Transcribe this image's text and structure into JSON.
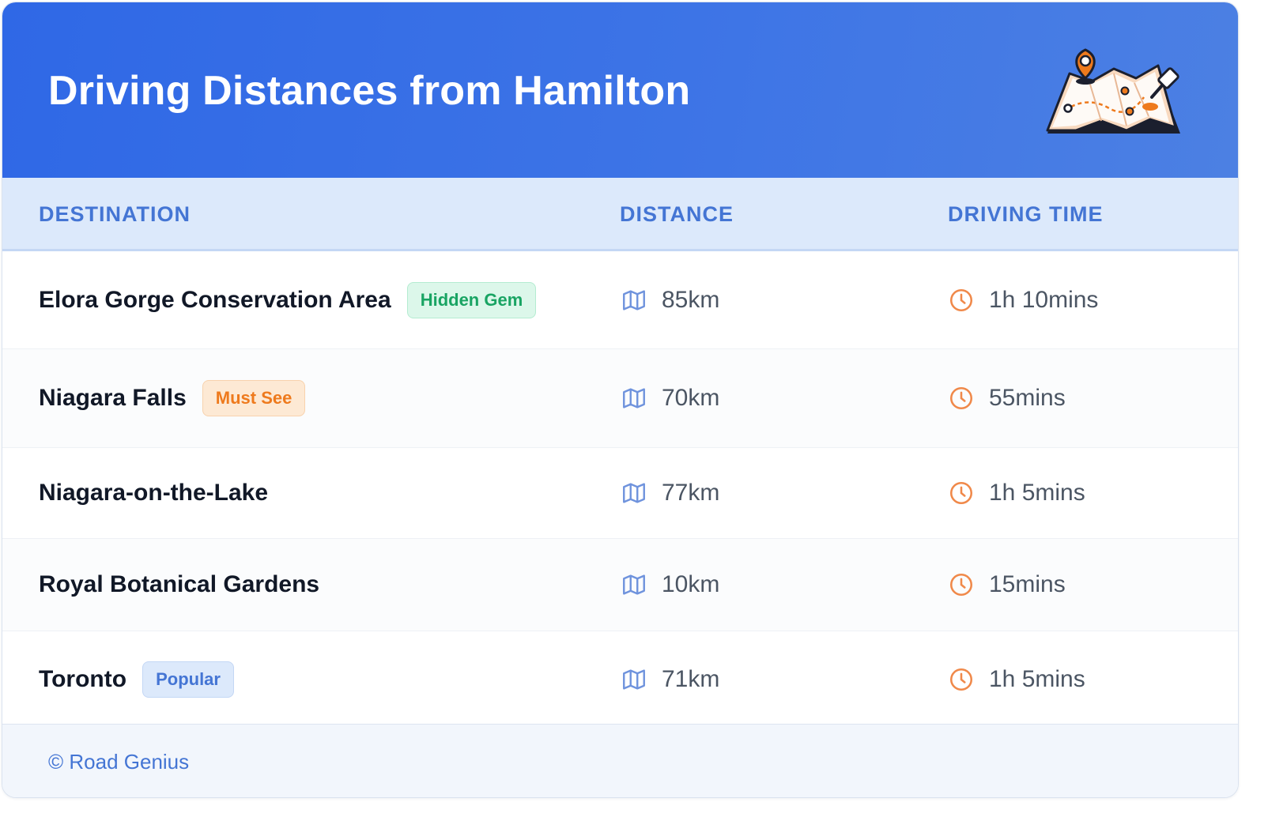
{
  "header": {
    "title": "Driving Distances from Hamilton",
    "illustration_icon": "map-with-pins-icon"
  },
  "columns": {
    "destination": "DESTINATION",
    "distance": "DISTANCE",
    "driving_time": "DRIVING TIME"
  },
  "rows": [
    {
      "destination": "Elora Gorge Conservation Area",
      "badge": "Hidden Gem",
      "badge_type": "hidden",
      "distance": "85km",
      "time": "1h 10mins"
    },
    {
      "destination": "Niagara Falls",
      "badge": "Must See",
      "badge_type": "must",
      "distance": "70km",
      "time": "55mins"
    },
    {
      "destination": "Niagara-on-the-Lake",
      "badge": "",
      "badge_type": "",
      "distance": "77km",
      "time": "1h 5mins"
    },
    {
      "destination": "Royal Botanical Gardens",
      "badge": "",
      "badge_type": "",
      "distance": "10km",
      "time": "15mins"
    },
    {
      "destination": "Toronto",
      "badge": "Popular",
      "badge_type": "popular",
      "distance": "71km",
      "time": "1h 5mins"
    }
  ],
  "icons": {
    "distance": "map-icon",
    "time": "clock-icon"
  },
  "colors": {
    "header_start": "#2f68e6",
    "header_end": "#4c80e3",
    "accent_blue": "#4475d4",
    "distance_icon": "#6f93dd",
    "time_icon": "#f0894a",
    "hidden_badge": "#19a463",
    "must_badge": "#ee7a1d"
  },
  "footer": {
    "credit": "© Road Genius"
  }
}
